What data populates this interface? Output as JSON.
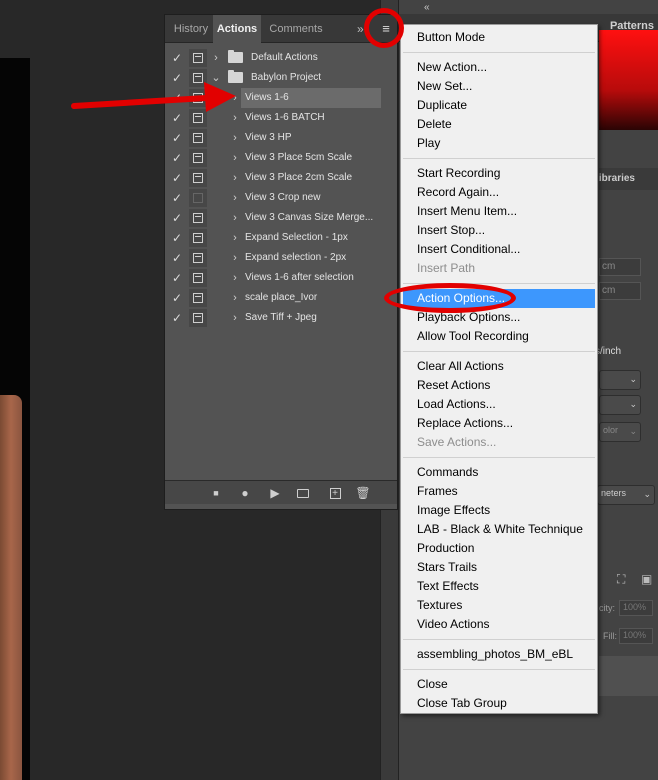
{
  "actions_panel": {
    "tabs": [
      "History",
      "Actions",
      "Comments"
    ],
    "active_tab": "Actions",
    "more_glyph": "»",
    "menu_button_icon": "hamburger-menu-icon",
    "items": [
      {
        "label": "Default Actions",
        "type": "set",
        "expanded": false,
        "checked": true,
        "dialog": true
      },
      {
        "label": "Babylon Project",
        "type": "set",
        "expanded": true,
        "checked": true,
        "dialog": true
      },
      {
        "label": "Views 1-6",
        "type": "action",
        "checked": true,
        "dialog": true,
        "selected": true
      },
      {
        "label": "Views 1-6 BATCH",
        "type": "action",
        "checked": true,
        "dialog": true
      },
      {
        "label": "View 3 HP",
        "type": "action",
        "checked": true,
        "dialog": true
      },
      {
        "label": "View 3 Place 5cm Scale",
        "type": "action",
        "checked": true,
        "dialog": true
      },
      {
        "label": "View 3 Place 2cm Scale",
        "type": "action",
        "checked": true,
        "dialog": true
      },
      {
        "label": "View 3 Crop new",
        "type": "action",
        "checked": true,
        "dialog": false
      },
      {
        "label": "View 3 Canvas Size Merge...",
        "type": "action",
        "checked": true,
        "dialog": true
      },
      {
        "label": "Expand Selection - 1px",
        "type": "action",
        "checked": true,
        "dialog": true
      },
      {
        "label": "Expand selection - 2px",
        "type": "action",
        "checked": true,
        "dialog": true
      },
      {
        "label": "Views 1-6 after selection",
        "type": "action",
        "checked": true,
        "dialog": true
      },
      {
        "label": "scale place_Ivor",
        "type": "action",
        "checked": true,
        "dialog": true
      },
      {
        "label": "Save Tiff + Jpeg",
        "type": "action",
        "checked": true,
        "dialog": true
      }
    ],
    "bottom_toolbar": [
      "stop-icon",
      "record-icon",
      "play-icon",
      "new-set-icon",
      "new-action-icon",
      "delete-icon"
    ]
  },
  "panel_menu": {
    "groups": [
      [
        {
          "label": "Button Mode",
          "enabled": true
        }
      ],
      [
        {
          "label": "New Action...",
          "enabled": true
        },
        {
          "label": "New Set...",
          "enabled": true
        },
        {
          "label": "Duplicate",
          "enabled": true
        },
        {
          "label": "Delete",
          "enabled": true
        },
        {
          "label": "Play",
          "enabled": true
        }
      ],
      [
        {
          "label": "Start Recording",
          "enabled": true
        },
        {
          "label": "Record Again...",
          "enabled": true
        },
        {
          "label": "Insert Menu Item...",
          "enabled": true
        },
        {
          "label": "Insert Stop...",
          "enabled": true
        },
        {
          "label": "Insert Conditional...",
          "enabled": true
        },
        {
          "label": "Insert Path",
          "enabled": false
        }
      ],
      [
        {
          "label": "Action Options...",
          "enabled": true,
          "highlighted": true
        },
        {
          "label": "Playback Options...",
          "enabled": true
        },
        {
          "label": "Allow Tool Recording",
          "enabled": true
        }
      ],
      [
        {
          "label": "Clear All Actions",
          "enabled": true
        },
        {
          "label": "Reset Actions",
          "enabled": true
        },
        {
          "label": "Load Actions...",
          "enabled": true
        },
        {
          "label": "Replace Actions...",
          "enabled": true
        },
        {
          "label": "Save Actions...",
          "enabled": false
        }
      ],
      [
        {
          "label": "Commands",
          "enabled": true
        },
        {
          "label": "Frames",
          "enabled": true
        },
        {
          "label": "Image Effects",
          "enabled": true
        },
        {
          "label": "LAB - Black & White Technique",
          "enabled": true
        },
        {
          "label": "Production",
          "enabled": true
        },
        {
          "label": "Stars Trails",
          "enabled": true
        },
        {
          "label": "Text Effects",
          "enabled": true
        },
        {
          "label": "Textures",
          "enabled": true
        },
        {
          "label": "Video Actions",
          "enabled": true
        }
      ],
      [
        {
          "label": "assembling_photos_BM_eBL",
          "enabled": true
        }
      ],
      [
        {
          "label": "Close",
          "enabled": true
        },
        {
          "label": "Close Tab Group",
          "enabled": true
        }
      ]
    ],
    "highlight_color": "#3d97fd"
  },
  "right_panel": {
    "tab_label": "Patterns",
    "collapse_glyph": "«",
    "libraries_tab": "ibraries",
    "field_unit_1": "cm",
    "field_unit_2": "cm",
    "resolution_unit": "s/inch",
    "color_mode_select": "olor",
    "units_select": "neters",
    "opacity_label": "city:",
    "opacity_value": "100%",
    "fill_label": "Fill:",
    "fill_value": "100%"
  },
  "annotations": {
    "color": "#e20000",
    "shapes": [
      "circle around panel-menu-button",
      "ellipse around Action Options...",
      "arrow pointing to Views 1-6"
    ]
  }
}
